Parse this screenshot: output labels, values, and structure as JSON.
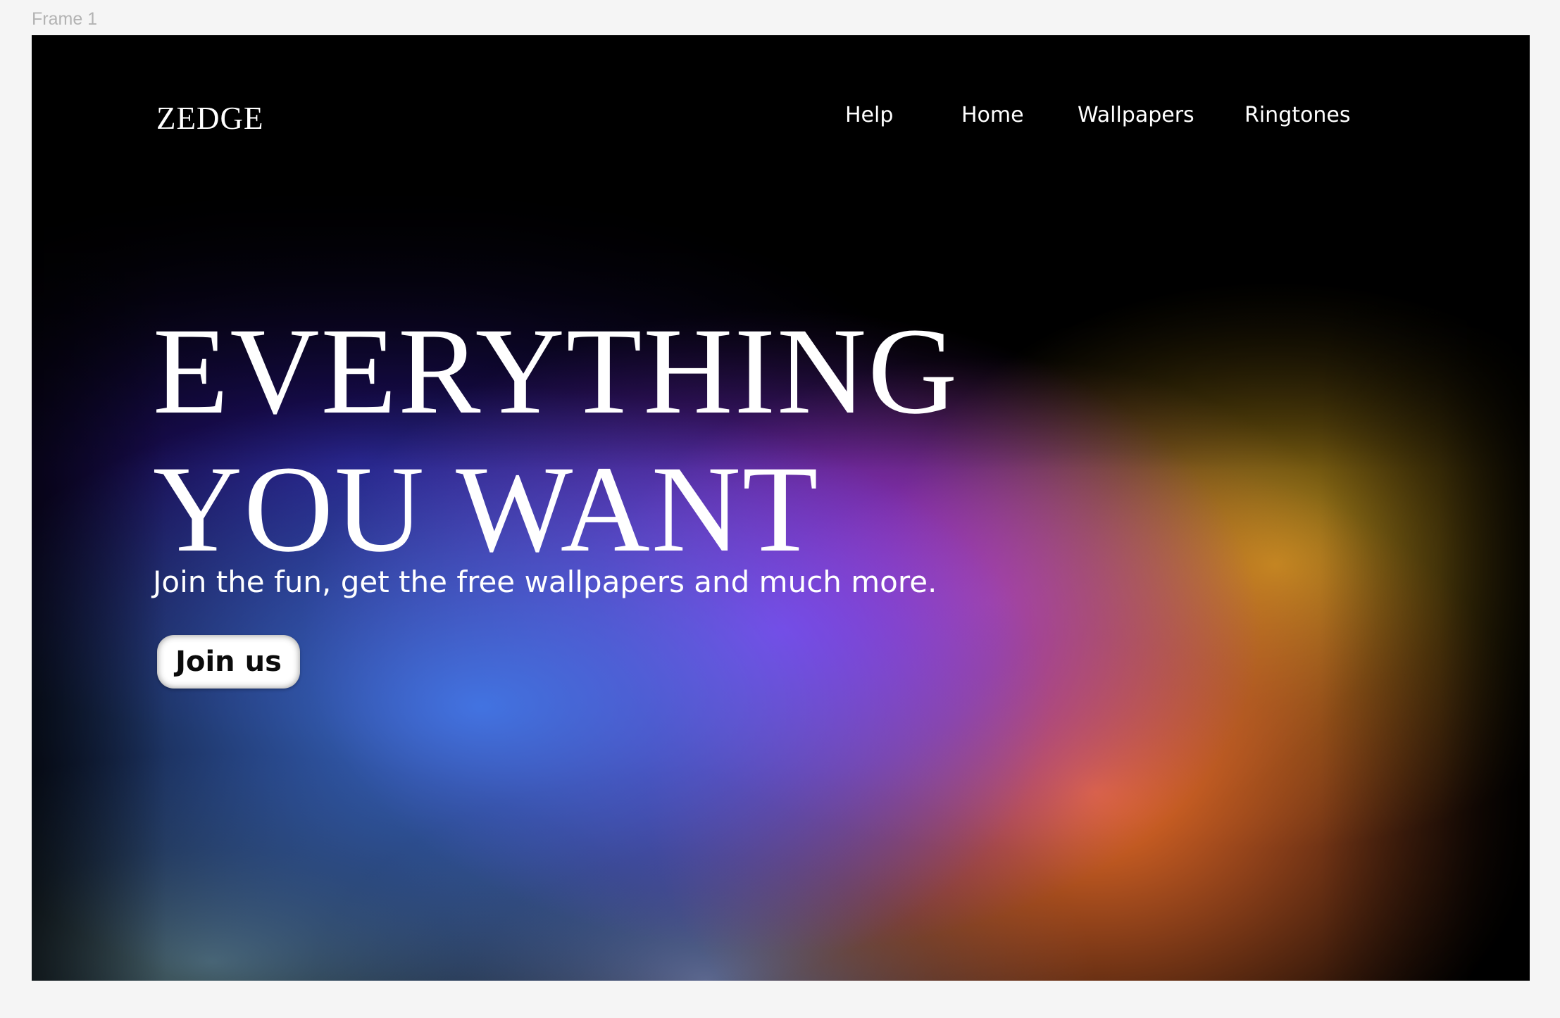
{
  "canvas": {
    "frame_label": "Frame 1"
  },
  "nav": {
    "logo": "ZEDGE",
    "links": [
      {
        "label": "Help"
      },
      {
        "label": "Home"
      },
      {
        "label": "Wallpapers"
      },
      {
        "label": "Ringtones"
      }
    ]
  },
  "hero": {
    "title_line_1": "EVERYTHING",
    "title_line_2": "YOU WANT",
    "subtitle": "Join the fun, get the free wallpapers and much more.",
    "cta_label": "Join us"
  },
  "colors": {
    "canvas_background": "#f5f5f5",
    "frame_background": "#000000",
    "text": "#ffffff",
    "button_background": "#ffffff",
    "button_text": "#0b0b0b",
    "gradient_blue": "#4378e8",
    "gradient_purple": "#9630e6",
    "gradient_orange": "#ec6e28",
    "gradient_gold": "#c49620",
    "gradient_pink": "#d85896"
  }
}
